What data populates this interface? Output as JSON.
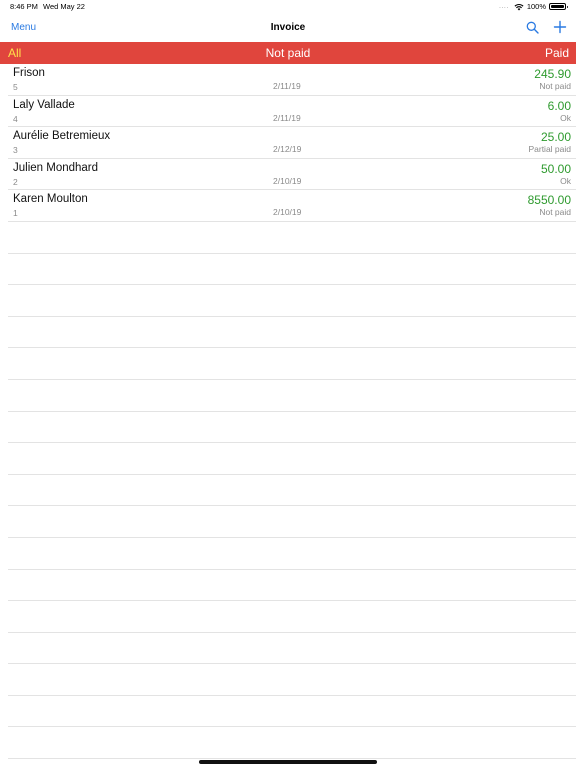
{
  "status_bar": {
    "time": "8:46 PM",
    "date": "Wed May 22",
    "signal": "....",
    "battery": "100%",
    "icons": [
      "wifi-icon",
      "battery-icon"
    ]
  },
  "nav": {
    "menu_label": "Menu",
    "title": "Invoice",
    "icons": [
      "search-icon",
      "plus-icon"
    ],
    "accent_color": "#2a7ae2"
  },
  "filters": {
    "all_label": "All",
    "not_paid_label": "Not paid",
    "paid_label": "Paid",
    "bar_color": "#e0453d",
    "selected_color": "#ffe14a"
  },
  "invoices": [
    {
      "name": "Frison",
      "number": "5",
      "date": "2/11/19",
      "amount": "245.90",
      "status": "Not paid"
    },
    {
      "name": "Laly Vallade",
      "number": "4",
      "date": "2/11/19",
      "amount": "6.00",
      "status": "Ok"
    },
    {
      "name": "Aurélie Betremieux",
      "number": "3",
      "date": "2/12/19",
      "amount": "25.00",
      "status": "Partial paid"
    },
    {
      "name": "Julien Mondhard",
      "number": "2",
      "date": "2/10/19",
      "amount": "50.00",
      "status": "Ok"
    },
    {
      "name": "Karen Moulton",
      "number": "1",
      "date": "2/10/19",
      "amount": "8550.00",
      "status": "Not paid"
    }
  ],
  "colors": {
    "amount": "#2e9a2e",
    "secondary_text": "#8a8a8a"
  }
}
